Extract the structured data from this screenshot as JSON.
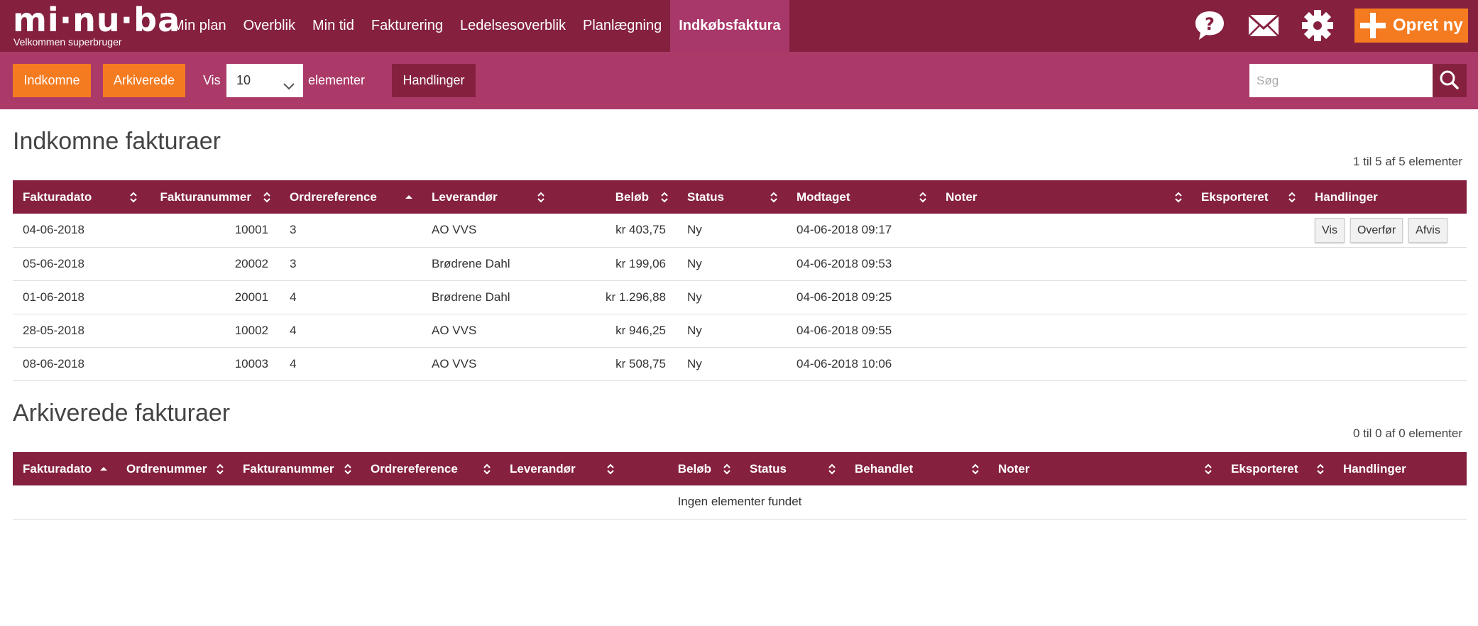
{
  "app": {
    "logo": "mi·nu·ba",
    "welcome": "Velkommen  superbruger"
  },
  "nav": {
    "items": [
      "Min plan",
      "Overblik",
      "Min tid",
      "Fakturering",
      "Ledelsesoverblik",
      "Planlægning",
      "Indkøbsfaktura"
    ],
    "active_index": 6,
    "new_label": "Opret ny"
  },
  "toolbar": {
    "incoming_label": "Indkomne",
    "archived_label": "Arkiverede",
    "show_label": "Vis",
    "page_size": "10",
    "elements_label": "elementer",
    "actions_label": "Handlinger",
    "search_placeholder": "Søg"
  },
  "incoming": {
    "title": "Indkomne fakturaer",
    "count": "1 til 5 af 5 elementer",
    "columns": [
      "Fakturadato",
      "Fakturanummer",
      "Ordrereference",
      "Leverandør",
      "Beløb",
      "Status",
      "Modtaget",
      "Noter",
      "Eksporteret",
      "Handlinger"
    ],
    "rows": [
      [
        "04-06-2018",
        "10001",
        "3",
        "AO VVS",
        "kr 403,75",
        "Ny",
        "04-06-2018 09:17",
        "",
        "",
        ""
      ],
      [
        "05-06-2018",
        "20002",
        "3",
        "Brødrene Dahl",
        "kr 199,06",
        "Ny",
        "04-06-2018 09:53",
        "",
        "",
        ""
      ],
      [
        "01-06-2018",
        "20001",
        "4",
        "Brødrene Dahl",
        "kr 1.296,88",
        "Ny",
        "04-06-2018 09:25",
        "",
        "",
        ""
      ],
      [
        "28-05-2018",
        "10002",
        "4",
        "AO VVS",
        "kr 946,25",
        "Ny",
        "04-06-2018 09:55",
        "",
        "",
        ""
      ],
      [
        "08-06-2018",
        "10003",
        "4",
        "AO VVS",
        "kr 508,75",
        "Ny",
        "04-06-2018 10:06",
        "",
        "",
        ""
      ]
    ],
    "row_actions": [
      "Vis",
      "Overfør",
      "Afvis"
    ]
  },
  "archived": {
    "title": "Arkiverede fakturaer",
    "count": "0 til 0 af 0 elementer",
    "columns": [
      "Fakturadato",
      "Ordrenummer",
      "Fakturanummer",
      "Ordrereference",
      "Leverandør",
      "Beløb",
      "Status",
      "Behandlet",
      "Noter",
      "Eksporteret",
      "Handlinger"
    ],
    "empty": "Ingen elementer fundet"
  },
  "colors": {
    "primary": "#85213f",
    "secondary": "#ab3a69",
    "accent": "#f47b20"
  }
}
